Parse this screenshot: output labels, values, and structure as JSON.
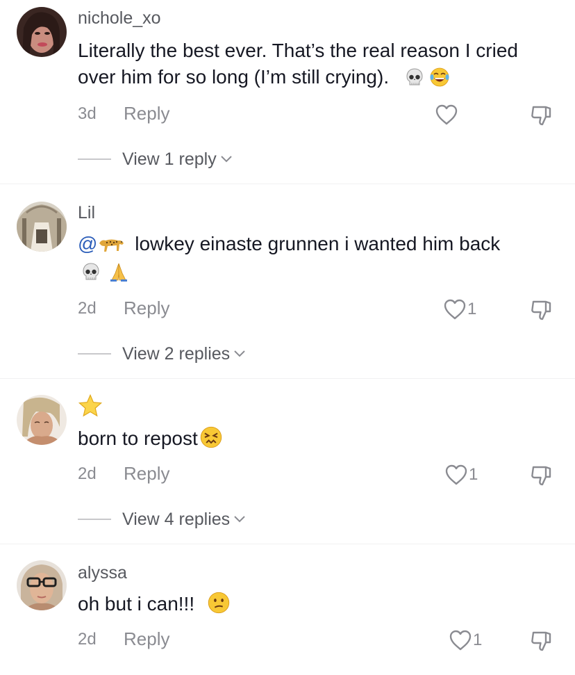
{
  "comments": [
    {
      "username": "nichole_xo",
      "text": "Literally the best ever. That’s the real reason I cried over him for so long (I’m still crying).",
      "time": "3d",
      "reply_label": "Reply",
      "likes": "",
      "view_replies": "View 1 reply",
      "emojis": [
        "skull-emoji",
        "laughing-emoji"
      ]
    },
    {
      "username": "Lil",
      "mention": "@",
      "text": "lowkey einaste grunnen i wanted him back",
      "time": "2d",
      "reply_label": "Reply",
      "likes": "1",
      "view_replies": "View 2 replies",
      "emojis": [
        "leopard-emoji",
        "skull-emoji",
        "praying-hands-emoji"
      ]
    },
    {
      "username": "",
      "text": "born to repost",
      "time": "2d",
      "reply_label": "Reply",
      "likes": "1",
      "view_replies": "View 4 replies",
      "emojis": [
        "star-emoji",
        "persevering-face-emoji"
      ]
    },
    {
      "username": "alyssa",
      "text": "oh but i can!!!",
      "time": "2d",
      "reply_label": "Reply",
      "likes": "1",
      "emojis": [
        "confused-face-emoji"
      ]
    }
  ],
  "colors": {
    "text": "#161823",
    "muted": "#8a8b91",
    "username": "#57595f",
    "mention": "#2b5db9"
  }
}
